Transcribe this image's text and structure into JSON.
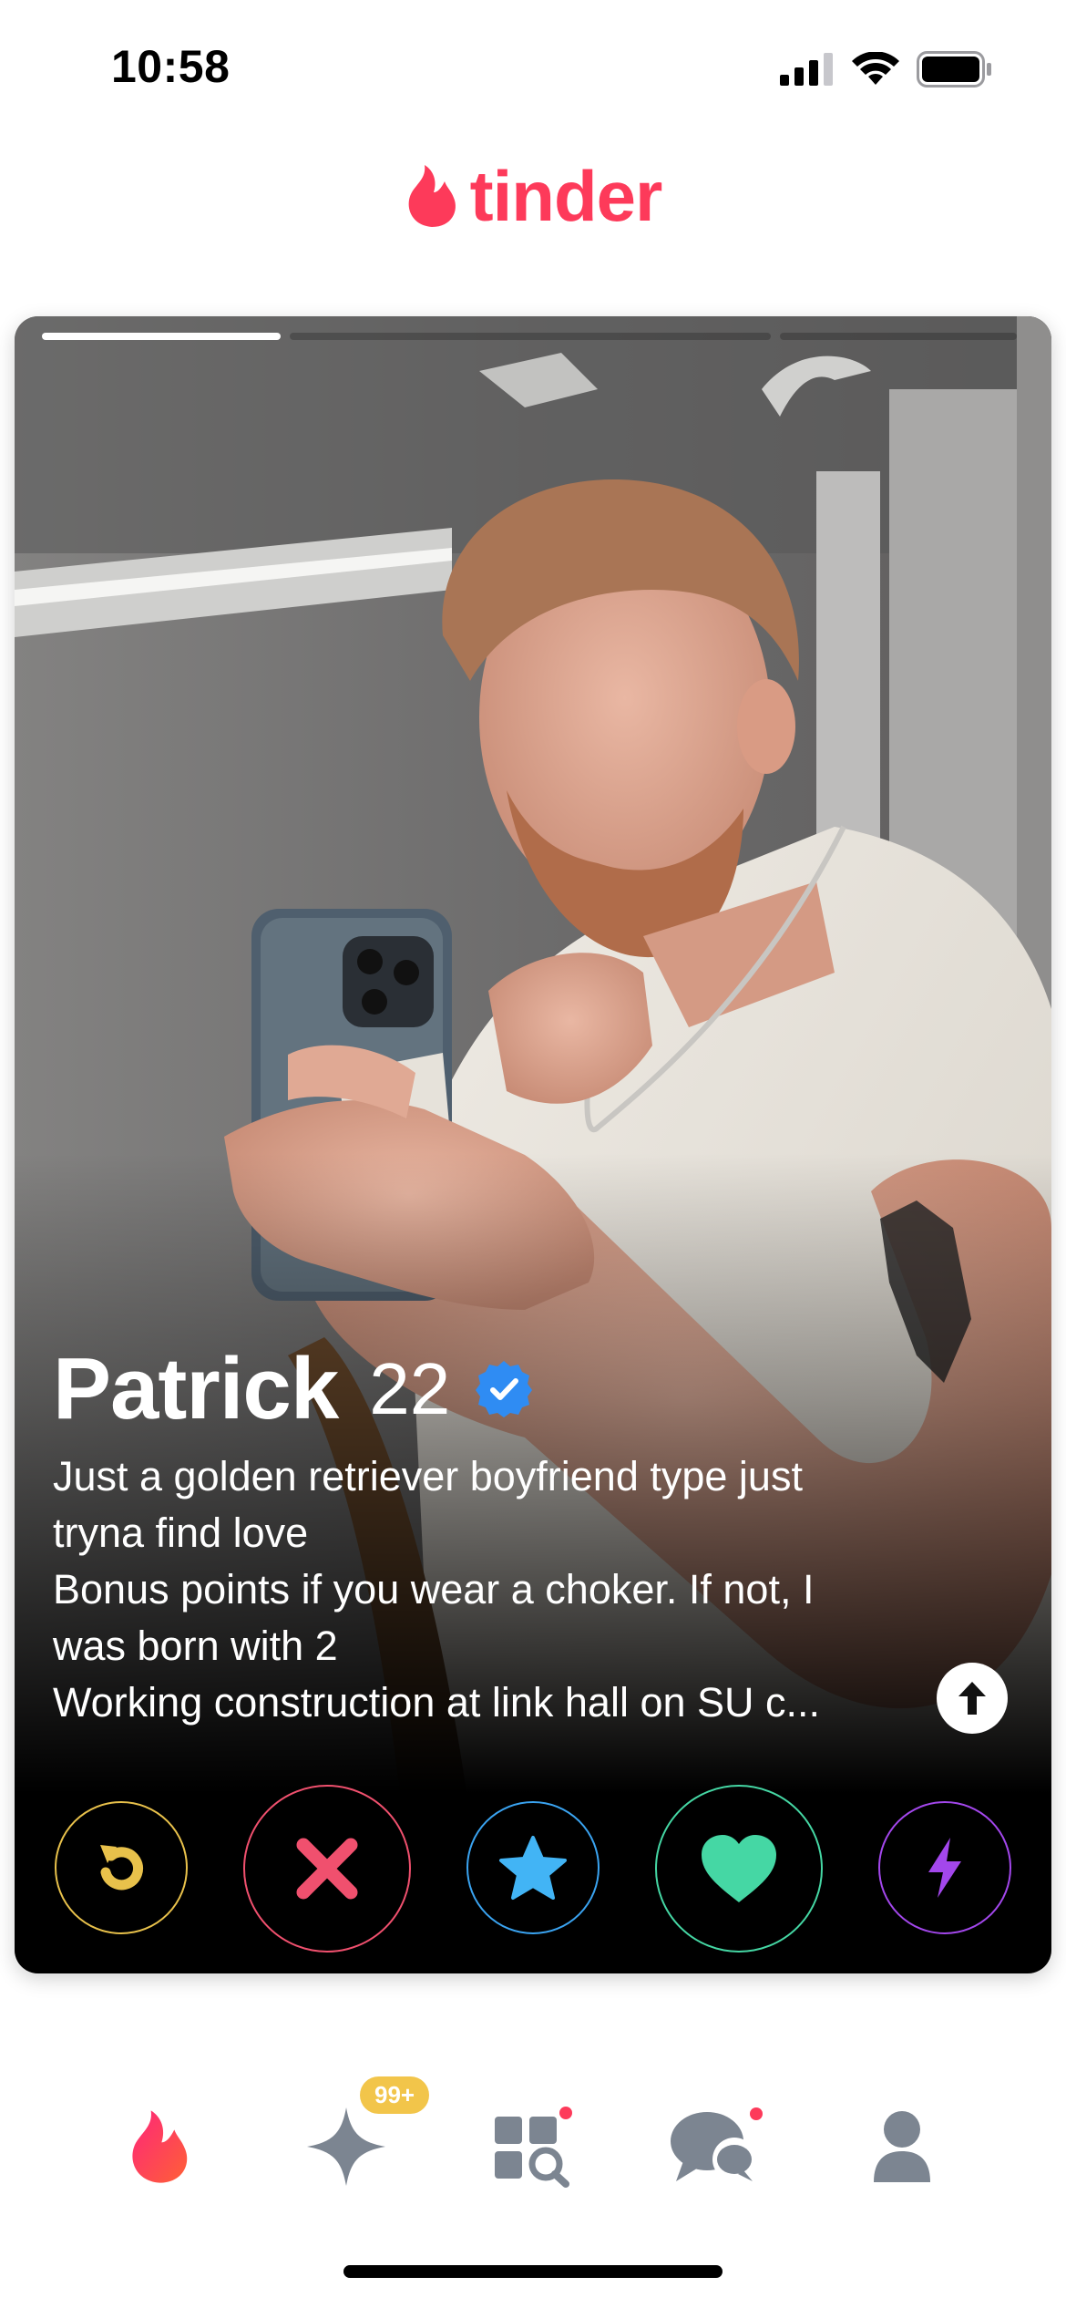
{
  "status_bar": {
    "time": "10:58"
  },
  "header": {
    "logo_text": "tinder"
  },
  "card": {
    "photo_count": 3,
    "active_photo": 0,
    "name": "Patrick",
    "age": "22",
    "verified": true,
    "bio_lines": [
      "Just a golden retriever boyfriend type just",
      "tryna find love",
      "Bonus points if you wear a choker. If not, I",
      "was born with 2",
      "Working construction at link hall on SU c..."
    ]
  },
  "actions": [
    {
      "name": "rewind",
      "icon": "rewind-icon",
      "color": "#e8c14b"
    },
    {
      "name": "nope",
      "icon": "close-icon",
      "color": "#f0506e"
    },
    {
      "name": "super-like",
      "icon": "star-icon",
      "color": "#3aa3f0"
    },
    {
      "name": "like",
      "icon": "heart-icon",
      "color": "#45d7a4"
    },
    {
      "name": "boost",
      "icon": "lightning-icon",
      "color": "#a347ec"
    }
  ],
  "bottom_nav": {
    "items": [
      "home",
      "gold",
      "explore",
      "chat",
      "profile"
    ],
    "gold_badge": "99+"
  },
  "colors": {
    "brand": "#fd3a5a",
    "nav_gray": "#7c8591"
  }
}
